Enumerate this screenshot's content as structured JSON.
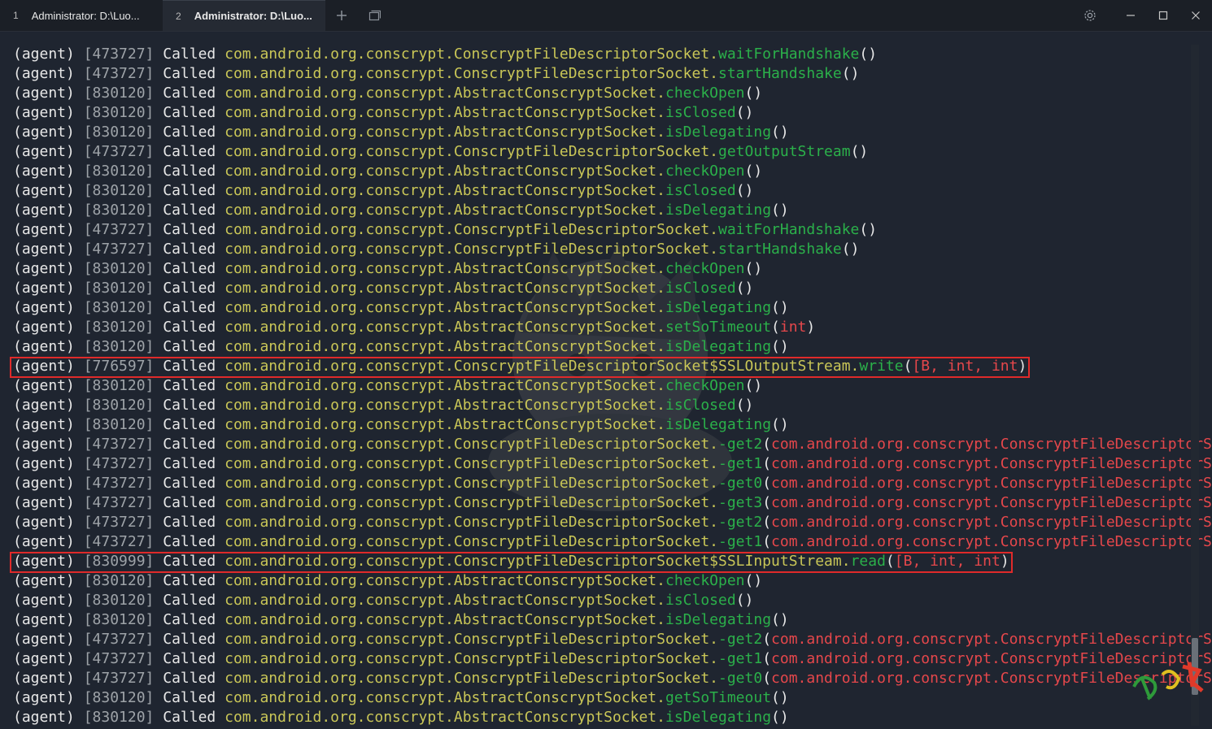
{
  "tabs": [
    {
      "num": "1",
      "label": "Administrator: D:\\Luo...",
      "active": false
    },
    {
      "num": "2",
      "label": "Administrator: D:\\Luo...",
      "active": true
    }
  ],
  "toolbar": {
    "new_tab": "plus-icon",
    "split": "window-icon",
    "settings": "gear-icon",
    "minimize": "minimize-icon",
    "maximize": "maximize-icon",
    "close": "close-icon"
  },
  "colors": {
    "background": "#1f2530",
    "class": "#c9c657",
    "method": "#2bb04a",
    "args": "#e5474b",
    "highlight": "#e02a2a"
  },
  "lines": [
    {
      "agent": "(agent)",
      "pid": "[473727]",
      "called": "Called",
      "cls": "com.android.org.conscrypt.ConscryptFileDescriptorSocket",
      "dot": ".",
      "method": "waitForHandshake",
      "open": "(",
      "args": "",
      "close": ")"
    },
    {
      "agent": "(agent)",
      "pid": "[473727]",
      "called": "Called",
      "cls": "com.android.org.conscrypt.ConscryptFileDescriptorSocket",
      "dot": ".",
      "method": "startHandshake",
      "open": "(",
      "args": "",
      "close": ")"
    },
    {
      "agent": "(agent)",
      "pid": "[830120]",
      "called": "Called",
      "cls": "com.android.org.conscrypt.AbstractConscryptSocket",
      "dot": ".",
      "method": "checkOpen",
      "open": "(",
      "args": "",
      "close": ")"
    },
    {
      "agent": "(agent)",
      "pid": "[830120]",
      "called": "Called",
      "cls": "com.android.org.conscrypt.AbstractConscryptSocket",
      "dot": ".",
      "method": "isClosed",
      "open": "(",
      "args": "",
      "close": ")"
    },
    {
      "agent": "(agent)",
      "pid": "[830120]",
      "called": "Called",
      "cls": "com.android.org.conscrypt.AbstractConscryptSocket",
      "dot": ".",
      "method": "isDelegating",
      "open": "(",
      "args": "",
      "close": ")"
    },
    {
      "agent": "(agent)",
      "pid": "[473727]",
      "called": "Called",
      "cls": "com.android.org.conscrypt.ConscryptFileDescriptorSocket",
      "dot": ".",
      "method": "getOutputStream",
      "open": "(",
      "args": "",
      "close": ")"
    },
    {
      "agent": "(agent)",
      "pid": "[830120]",
      "called": "Called",
      "cls": "com.android.org.conscrypt.AbstractConscryptSocket",
      "dot": ".",
      "method": "checkOpen",
      "open": "(",
      "args": "",
      "close": ")"
    },
    {
      "agent": "(agent)",
      "pid": "[830120]",
      "called": "Called",
      "cls": "com.android.org.conscrypt.AbstractConscryptSocket",
      "dot": ".",
      "method": "isClosed",
      "open": "(",
      "args": "",
      "close": ")"
    },
    {
      "agent": "(agent)",
      "pid": "[830120]",
      "called": "Called",
      "cls": "com.android.org.conscrypt.AbstractConscryptSocket",
      "dot": ".",
      "method": "isDelegating",
      "open": "(",
      "args": "",
      "close": ")"
    },
    {
      "agent": "(agent)",
      "pid": "[473727]",
      "called": "Called",
      "cls": "com.android.org.conscrypt.ConscryptFileDescriptorSocket",
      "dot": ".",
      "method": "waitForHandshake",
      "open": "(",
      "args": "",
      "close": ")"
    },
    {
      "agent": "(agent)",
      "pid": "[473727]",
      "called": "Called",
      "cls": "com.android.org.conscrypt.ConscryptFileDescriptorSocket",
      "dot": ".",
      "method": "startHandshake",
      "open": "(",
      "args": "",
      "close": ")"
    },
    {
      "agent": "(agent)",
      "pid": "[830120]",
      "called": "Called",
      "cls": "com.android.org.conscrypt.AbstractConscryptSocket",
      "dot": ".",
      "method": "checkOpen",
      "open": "(",
      "args": "",
      "close": ")"
    },
    {
      "agent": "(agent)",
      "pid": "[830120]",
      "called": "Called",
      "cls": "com.android.org.conscrypt.AbstractConscryptSocket",
      "dot": ".",
      "method": "isClosed",
      "open": "(",
      "args": "",
      "close": ")"
    },
    {
      "agent": "(agent)",
      "pid": "[830120]",
      "called": "Called",
      "cls": "com.android.org.conscrypt.AbstractConscryptSocket",
      "dot": ".",
      "method": "isDelegating",
      "open": "(",
      "args": "",
      "close": ")"
    },
    {
      "agent": "(agent)",
      "pid": "[830120]",
      "called": "Called",
      "cls": "com.android.org.conscrypt.AbstractConscryptSocket",
      "dot": ".",
      "method": "setSoTimeout",
      "open": "(",
      "args": "int",
      "close": ")"
    },
    {
      "agent": "(agent)",
      "pid": "[830120]",
      "called": "Called",
      "cls": "com.android.org.conscrypt.AbstractConscryptSocket",
      "dot": ".",
      "method": "isDelegating",
      "open": "(",
      "args": "",
      "close": ")"
    },
    {
      "agent": "(agent)",
      "pid": "[776597]",
      "called": "Called",
      "cls": "com.android.org.conscrypt.ConscryptFileDescriptorSocket$SSLOutputStream",
      "dot": ".",
      "method": "write",
      "open": "(",
      "args": "[B, int, int",
      "close": ")",
      "highlight": true
    },
    {
      "agent": "(agent)",
      "pid": "[830120]",
      "called": "Called",
      "cls": "com.android.org.conscrypt.AbstractConscryptSocket",
      "dot": ".",
      "method": "checkOpen",
      "open": "(",
      "args": "",
      "close": ")"
    },
    {
      "agent": "(agent)",
      "pid": "[830120]",
      "called": "Called",
      "cls": "com.android.org.conscrypt.AbstractConscryptSocket",
      "dot": ".",
      "method": "isClosed",
      "open": "(",
      "args": "",
      "close": ")"
    },
    {
      "agent": "(agent)",
      "pid": "[830120]",
      "called": "Called",
      "cls": "com.android.org.conscrypt.AbstractConscryptSocket",
      "dot": ".",
      "method": "isDelegating",
      "open": "(",
      "args": "",
      "close": ")"
    },
    {
      "agent": "(agent)",
      "pid": "[473727]",
      "called": "Called",
      "cls": "com.android.org.conscrypt.ConscryptFileDescriptorSocket",
      "dot": ".",
      "method": "-get2",
      "open": "(",
      "args": "com.android.org.conscrypt.ConscryptFileDescriptorSocket",
      "close": ")"
    },
    {
      "agent": "(agent)",
      "pid": "[473727]",
      "called": "Called",
      "cls": "com.android.org.conscrypt.ConscryptFileDescriptorSocket",
      "dot": ".",
      "method": "-get1",
      "open": "(",
      "args": "com.android.org.conscrypt.ConscryptFileDescriptorSocket",
      "close": ")"
    },
    {
      "agent": "(agent)",
      "pid": "[473727]",
      "called": "Called",
      "cls": "com.android.org.conscrypt.ConscryptFileDescriptorSocket",
      "dot": ".",
      "method": "-get0",
      "open": "(",
      "args": "com.android.org.conscrypt.ConscryptFileDescriptorSocket",
      "close": ")"
    },
    {
      "agent": "(agent)",
      "pid": "[473727]",
      "called": "Called",
      "cls": "com.android.org.conscrypt.ConscryptFileDescriptorSocket",
      "dot": ".",
      "method": "-get3",
      "open": "(",
      "args": "com.android.org.conscrypt.ConscryptFileDescriptorSocket",
      "close": ")"
    },
    {
      "agent": "(agent)",
      "pid": "[473727]",
      "called": "Called",
      "cls": "com.android.org.conscrypt.ConscryptFileDescriptorSocket",
      "dot": ".",
      "method": "-get2",
      "open": "(",
      "args": "com.android.org.conscrypt.ConscryptFileDescriptorSocket",
      "close": ")"
    },
    {
      "agent": "(agent)",
      "pid": "[473727]",
      "called": "Called",
      "cls": "com.android.org.conscrypt.ConscryptFileDescriptorSocket",
      "dot": ".",
      "method": "-get1",
      "open": "(",
      "args": "com.android.org.conscrypt.ConscryptFileDescriptorSocket",
      "close": ")"
    },
    {
      "agent": "(agent)",
      "pid": "[830999]",
      "called": "Called",
      "cls": "com.android.org.conscrypt.ConscryptFileDescriptorSocket$SSLInputStream",
      "dot": ".",
      "method": "read",
      "open": "(",
      "args": "[B, int, int",
      "close": ")",
      "highlight": true
    },
    {
      "agent": "(agent)",
      "pid": "[830120]",
      "called": "Called",
      "cls": "com.android.org.conscrypt.AbstractConscryptSocket",
      "dot": ".",
      "method": "checkOpen",
      "open": "(",
      "args": "",
      "close": ")"
    },
    {
      "agent": "(agent)",
      "pid": "[830120]",
      "called": "Called",
      "cls": "com.android.org.conscrypt.AbstractConscryptSocket",
      "dot": ".",
      "method": "isClosed",
      "open": "(",
      "args": "",
      "close": ")"
    },
    {
      "agent": "(agent)",
      "pid": "[830120]",
      "called": "Called",
      "cls": "com.android.org.conscrypt.AbstractConscryptSocket",
      "dot": ".",
      "method": "isDelegating",
      "open": "(",
      "args": "",
      "close": ")"
    },
    {
      "agent": "(agent)",
      "pid": "[473727]",
      "called": "Called",
      "cls": "com.android.org.conscrypt.ConscryptFileDescriptorSocket",
      "dot": ".",
      "method": "-get2",
      "open": "(",
      "args": "com.android.org.conscrypt.ConscryptFileDescriptorSocket",
      "close": ")"
    },
    {
      "agent": "(agent)",
      "pid": "[473727]",
      "called": "Called",
      "cls": "com.android.org.conscrypt.ConscryptFileDescriptorSocket",
      "dot": ".",
      "method": "-get1",
      "open": "(",
      "args": "com.android.org.conscrypt.ConscryptFileDescriptorSocket",
      "close": ")"
    },
    {
      "agent": "(agent)",
      "pid": "[473727]",
      "called": "Called",
      "cls": "com.android.org.conscrypt.ConscryptFileDescriptorSocket",
      "dot": ".",
      "method": "-get0",
      "open": "(",
      "args": "com.android.org.conscrypt.ConscryptFileDescriptorSocket",
      "close": ")"
    },
    {
      "agent": "(agent)",
      "pid": "[830120]",
      "called": "Called",
      "cls": "com.android.org.conscrypt.AbstractConscryptSocket",
      "dot": ".",
      "method": "getSoTimeout",
      "open": "(",
      "args": "",
      "close": ")"
    },
    {
      "agent": "(agent)",
      "pid": "[830120]",
      "called": "Called",
      "cls": "com.android.org.conscrypt.AbstractConscryptSocket",
      "dot": ".",
      "method": "isDelegating",
      "open": "(",
      "args": "",
      "close": ")"
    }
  ]
}
